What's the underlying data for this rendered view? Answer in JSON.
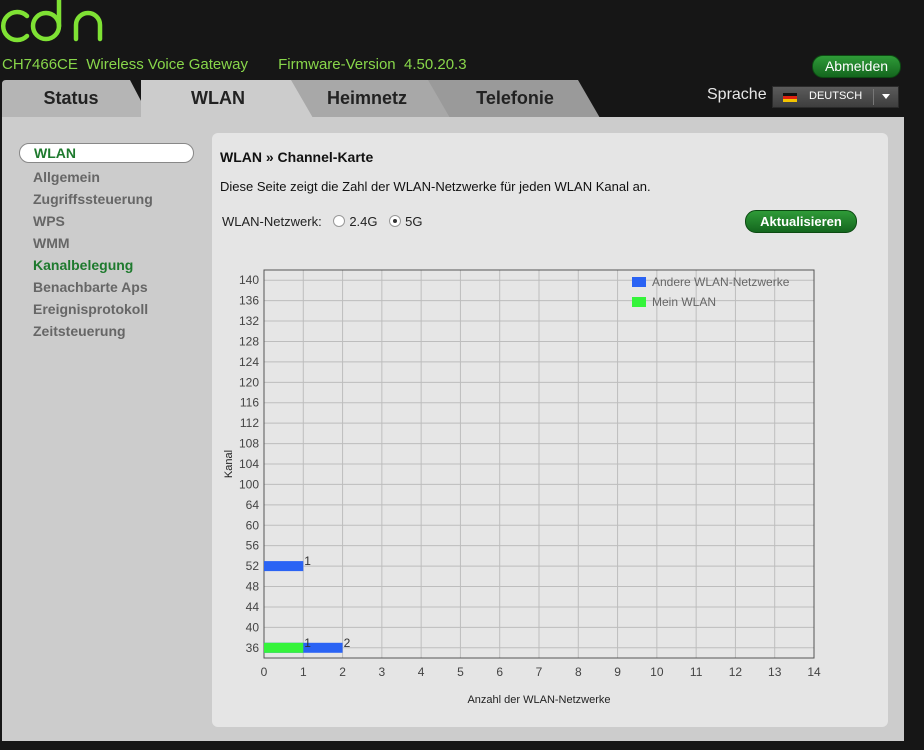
{
  "header": {
    "model": "CH7466CE",
    "product": "Wireless Voice Gateway",
    "firmware_label": "Firmware-Version",
    "firmware_version": "4.50.20.3",
    "logout_label": "Abmelden",
    "language_label": "Sprache",
    "language_value": "DEUTSCH"
  },
  "tabs": [
    {
      "label": "Status"
    },
    {
      "label": "WLAN"
    },
    {
      "label": "Heimnetz"
    },
    {
      "label": "Telefonie"
    }
  ],
  "sidebar": {
    "items": [
      {
        "label": "WLAN"
      },
      {
        "label": "Allgemein"
      },
      {
        "label": "Zugriffssteuerung"
      },
      {
        "label": "WPS"
      },
      {
        "label": "WMM"
      },
      {
        "label": "Kanalbelegung"
      },
      {
        "label": "Benachbarte Aps"
      },
      {
        "label": "Ereignisprotokoll"
      },
      {
        "label": "Zeitsteuerung"
      }
    ]
  },
  "content": {
    "title": "WLAN » Channel-Karte",
    "description": "Diese Seite zeigt die Zahl der WLAN-Netzwerke für jeden WLAN Kanal an.",
    "network_label": "WLAN-Netzwerk:",
    "option_24": "2.4G",
    "option_5": "5G",
    "selected_band": "5G",
    "refresh_label": "Aktualisieren"
  },
  "colors": {
    "brand_green": "#88d64a",
    "button_green": "#1e7a2e",
    "series_other": "#2a63f4",
    "series_mine": "#35f43b"
  },
  "chart_data": {
    "type": "bar",
    "orientation": "horizontal",
    "categories": [
      "36",
      "40",
      "44",
      "48",
      "52",
      "56",
      "60",
      "64",
      "100",
      "104",
      "108",
      "112",
      "116",
      "120",
      "124",
      "128",
      "132",
      "136",
      "140"
    ],
    "series": [
      {
        "name": "Andere WLAN-Netzwerke",
        "values": [
          2,
          0,
          0,
          0,
          1,
          0,
          0,
          0,
          0,
          0,
          0,
          0,
          0,
          0,
          0,
          0,
          0,
          0,
          0
        ]
      },
      {
        "name": "Mein WLAN",
        "values": [
          1,
          0,
          0,
          0,
          0,
          0,
          0,
          0,
          0,
          0,
          0,
          0,
          0,
          0,
          0,
          0,
          0,
          0,
          0
        ]
      }
    ],
    "data_labels": [
      {
        "category": "36",
        "series": "Andere WLAN-Netzwerke",
        "text": "2"
      },
      {
        "category": "36",
        "series": "Mein WLAN",
        "text": "1"
      },
      {
        "category": "52",
        "series": "Andere WLAN-Netzwerke",
        "text": "1"
      }
    ],
    "x_ticks": [
      "0",
      "1",
      "2",
      "3",
      "4",
      "5",
      "6",
      "7",
      "8",
      "9",
      "10",
      "11",
      "12",
      "13",
      "14"
    ],
    "xlim": [
      0,
      14
    ],
    "xlabel": "Anzahl der WLAN-Netzwerke",
    "ylabel": "Kanal",
    "grid": true,
    "legend": "top-right"
  }
}
